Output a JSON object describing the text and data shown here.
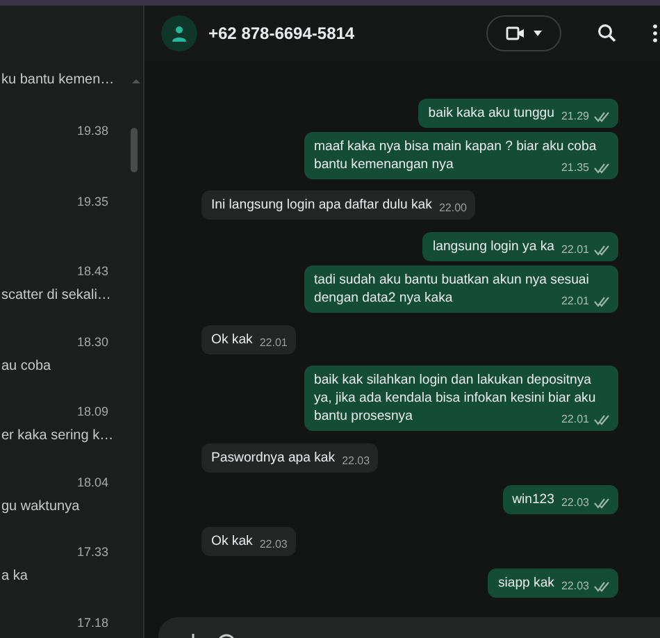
{
  "sidebar": {
    "items": [
      {
        "preview": "ku bantu kemen…"
      },
      {
        "time": "19.38"
      },
      {
        "time": "19.35"
      },
      {
        "time": "18.43",
        "preview": "scatter di sekali…"
      },
      {
        "time": "18.30",
        "preview": "au coba"
      },
      {
        "time": "18.09",
        "preview": "er kaka sering k…"
      },
      {
        "time": "18.04",
        "preview": "gu waktunya"
      },
      {
        "time": "17.33",
        "preview": "a ka"
      },
      {
        "time": "17.18"
      }
    ]
  },
  "header": {
    "contact": "+62 878-6694-5814"
  },
  "messages": [
    {
      "kind": "sent",
      "text": "baik kaka aku tunggu",
      "time": "21.29"
    },
    {
      "kind": "sent",
      "text": "maaf kaka nya bisa main kapan ? biar aku coba bantu kemenangan nya",
      "time": "21.35"
    },
    {
      "kind": "received",
      "text": "Ini langsung login apa daftar dulu kak",
      "time": "22.00"
    },
    {
      "kind": "sent",
      "text": "langsung login ya ka",
      "time": "22.01"
    },
    {
      "kind": "sent",
      "text": "tadi sudah aku bantu buatkan akun nya sesuai dengan data2 nya kaka",
      "time": "22.01"
    },
    {
      "kind": "received",
      "text": "Ok kak",
      "time": "22.01"
    },
    {
      "kind": "sent",
      "text": "baik kak silahkan login dan lakukan depositnya ya, jika ada kendala bisa infokan kesini biar aku bantu prosesnya",
      "time": "22.01"
    },
    {
      "kind": "received",
      "text": "Paswordnya apa kak",
      "time": "22.03"
    },
    {
      "kind": "sent",
      "text": "win123",
      "time": "22.03"
    },
    {
      "kind": "received",
      "text": "Ok kak",
      "time": "22.03"
    },
    {
      "kind": "sent",
      "text": "siapp kak",
      "time": "22.03"
    }
  ]
}
